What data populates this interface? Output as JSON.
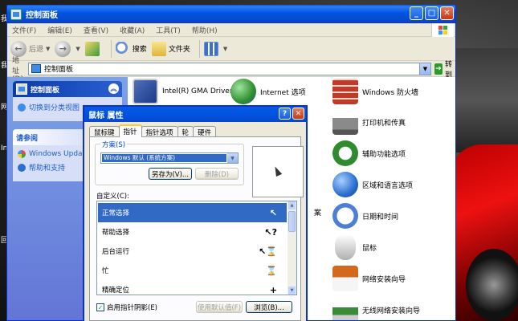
{
  "window": {
    "title": "控制面板",
    "controls": {
      "minimize": "_",
      "maximize": "□",
      "close": "✕"
    }
  },
  "menu": [
    "文件(F)",
    "编辑(E)",
    "查看(V)",
    "收藏(A)",
    "工具(T)",
    "帮助(H)"
  ],
  "toolbar": {
    "back": "后退",
    "search": "搜索",
    "folders": "文件夹"
  },
  "address": {
    "label": "地址(D)",
    "value": "控制面板",
    "go": "转到"
  },
  "taskpane": {
    "cp_title": "控制面板",
    "switch_link": "切换到分类视图",
    "see_also_title": "请参阅",
    "see_also_links": [
      "Windows Update",
      "帮助和支持"
    ]
  },
  "cpl_items": [
    {
      "label": "Intel(R) GMA Driver",
      "icon": "monitor-icon",
      "color": "#1a3a8a"
    },
    {
      "label": "Internet 选项",
      "icon": "globe-icon",
      "color": "#2f8f2f"
    },
    {
      "label": "Windows 防火墙",
      "icon": "firewall-icon",
      "color": "#c0392b"
    },
    {
      "label": "打印机和传真",
      "icon": "printer-icon",
      "color": "#8a8a8a"
    },
    {
      "label": "辅助功能选项",
      "icon": "accessibility-icon",
      "color": "#2e8b2e"
    },
    {
      "label": "区域和语言选项",
      "icon": "globe-icon",
      "color": "#2a6fcf"
    },
    {
      "label": "日期和时间",
      "icon": "calendar-icon",
      "color": "#4d7fd6"
    },
    {
      "label": "鼠标",
      "icon": "mouse-icon",
      "color": "#b0b0b0"
    },
    {
      "label": "网络安装向导",
      "icon": "house-icon",
      "color": "#d2691e"
    },
    {
      "label": "无线网络安装向导",
      "icon": "wireless-icon",
      "color": "#3a8a3a"
    }
  ],
  "partial_label": "案",
  "dialog": {
    "title": "鼠标 属性",
    "help": "?",
    "close": "✕",
    "tabs": [
      "鼠标键",
      "指针",
      "指针选项",
      "轮",
      "硬件"
    ],
    "active_tab": 1,
    "scheme_label": "方案(S)",
    "scheme_value": "Windows 默认 (系统方案)",
    "save_as": "另存为(V)...",
    "delete": "删除(D)",
    "custom_label": "自定义(C):",
    "cursors": [
      {
        "name": "正常选择",
        "glyph": "↖",
        "selected": true
      },
      {
        "name": "帮助选择",
        "glyph": "↖?",
        "selected": false
      },
      {
        "name": "后台运行",
        "glyph": "↖⌛",
        "selected": false
      },
      {
        "name": "忙",
        "glyph": "⌛",
        "selected": false
      },
      {
        "name": "精确定位",
        "glyph": "+",
        "selected": false
      }
    ],
    "shadow_label": "启用指针阴影(E)",
    "shadow_checked": "✓",
    "use_default": "使用默认值(F)",
    "browse": "浏览(B)..."
  },
  "desktop": {
    "left_labels": [
      "我",
      "我",
      "网",
      "In",
      "回"
    ]
  }
}
